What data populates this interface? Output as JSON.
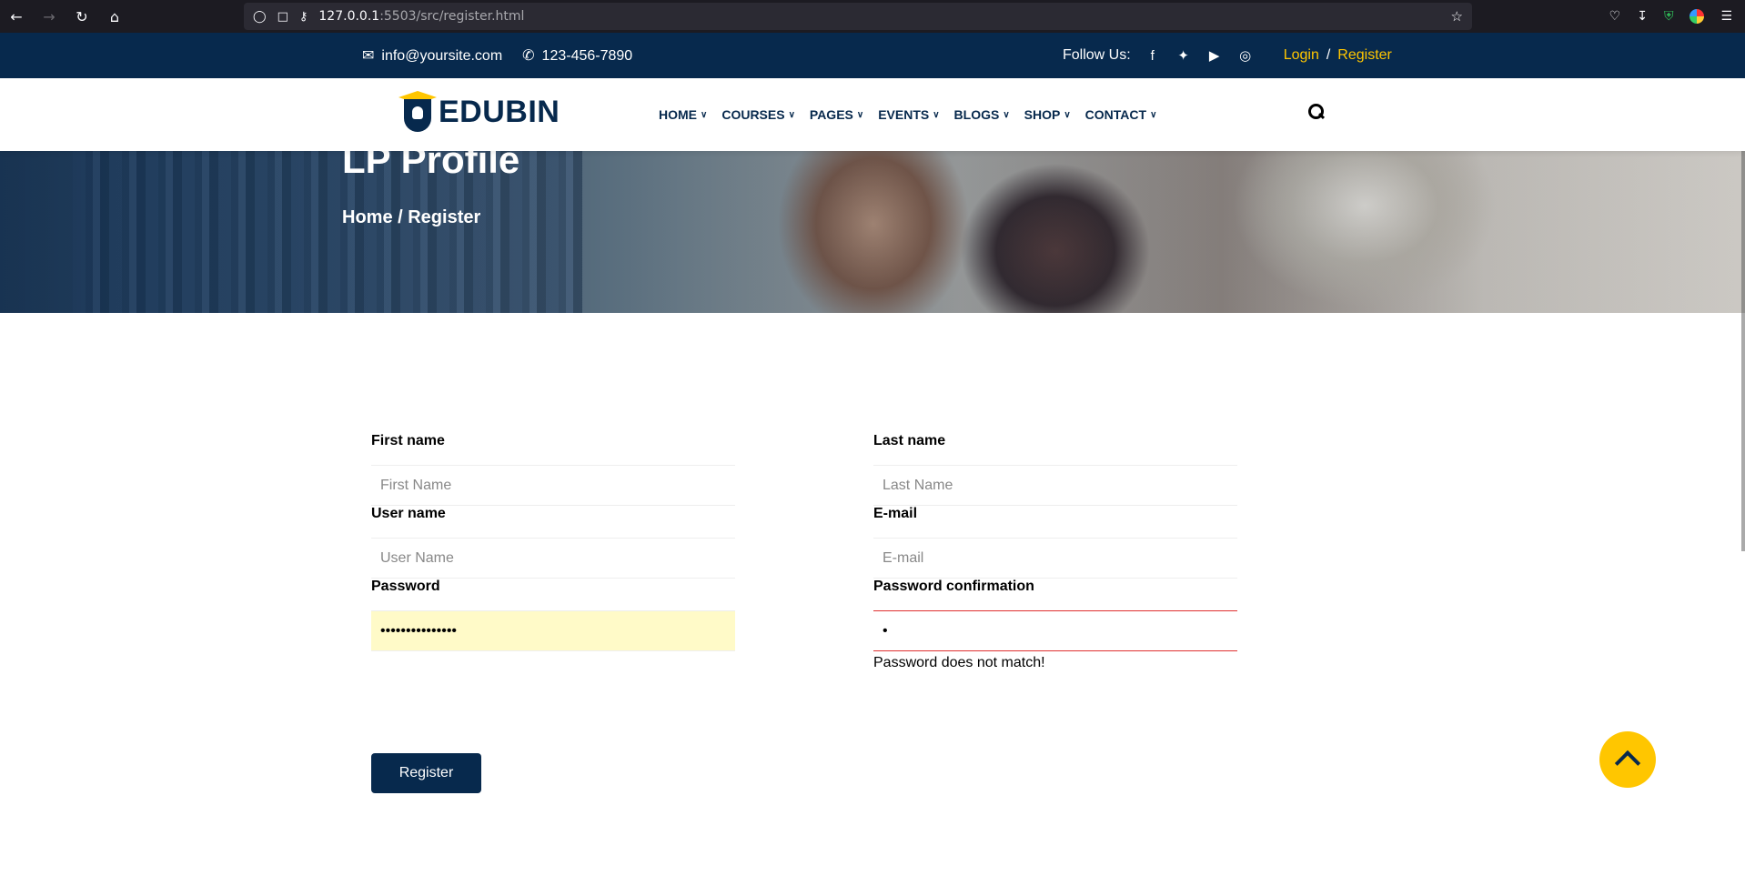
{
  "browser": {
    "url_host": "127.0.0.1",
    "url_path": ":5503/src/register.html"
  },
  "topbar": {
    "email": "info@yoursite.com",
    "phone": "123-456-7890",
    "follow_label": "Follow Us:",
    "social_icons": [
      "facebook-icon",
      "twitter-icon",
      "youtube-icon",
      "instagram-icon"
    ],
    "login_label": "Login",
    "separator": "/",
    "register_label": "Register"
  },
  "nav": {
    "logo_text": "EDUBIN",
    "items": [
      {
        "label": "HOME"
      },
      {
        "label": "COURSES"
      },
      {
        "label": "PAGES"
      },
      {
        "label": "EVENTS"
      },
      {
        "label": "BLOGS"
      },
      {
        "label": "SHOP"
      },
      {
        "label": "CONTACT"
      }
    ]
  },
  "hero": {
    "title": "LP Profile",
    "breadcrumb": "Home / Register"
  },
  "form": {
    "first_name": {
      "label": "First name",
      "placeholder": "First Name",
      "value": ""
    },
    "last_name": {
      "label": "Last name",
      "placeholder": "Last Name",
      "value": ""
    },
    "user_name": {
      "label": "User name",
      "placeholder": "User Name",
      "value": ""
    },
    "email": {
      "label": "E-mail",
      "placeholder": "E-mail",
      "value": ""
    },
    "password": {
      "label": "Password",
      "value": "•••••••••••••••"
    },
    "password_confirm": {
      "label": "Password confirmation",
      "value": "•",
      "error": "Password does not match!"
    },
    "submit_label": "Register"
  },
  "colors": {
    "navy": "#07294d",
    "accent": "#ffc600",
    "error": "#e03030"
  }
}
